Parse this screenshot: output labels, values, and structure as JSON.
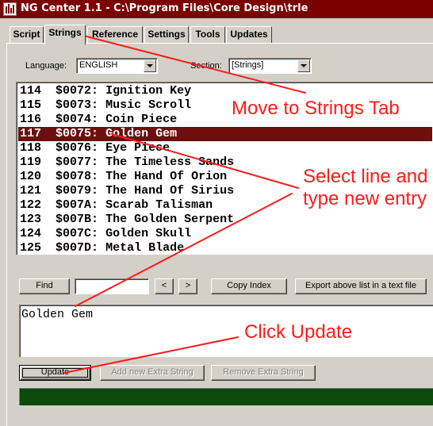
{
  "window": {
    "title": "NG Center 1.1 - C:\\Program Files\\Core Design\\trle"
  },
  "tabs": [
    {
      "label": "Script",
      "active": false
    },
    {
      "label": "Strings",
      "active": true
    },
    {
      "label": "Reference",
      "active": false
    },
    {
      "label": "Settings",
      "active": false
    },
    {
      "label": "Tools",
      "active": false
    },
    {
      "label": "Updates",
      "active": false
    }
  ],
  "filters": {
    "language_label": "Language:",
    "language_value": "ENGLISH",
    "section_label": "Section:",
    "section_value": "[Strings]"
  },
  "strings_list": {
    "rows": [
      {
        "index": "114",
        "code": "$0072:",
        "text": "Ignition Key"
      },
      {
        "index": "115",
        "code": "$0073:",
        "text": "Music Scroll"
      },
      {
        "index": "116",
        "code": "$0074:",
        "text": "Coin Piece"
      },
      {
        "index": "117",
        "code": "$0075:",
        "text": "Golden Gem"
      },
      {
        "index": "118",
        "code": "$0076:",
        "text": "Eye Piece"
      },
      {
        "index": "119",
        "code": "$0077:",
        "text": "The Timeless Sands"
      },
      {
        "index": "120",
        "code": "$0078:",
        "text": "The Hand Of Orion"
      },
      {
        "index": "121",
        "code": "$0079:",
        "text": "The Hand Of Sirius"
      },
      {
        "index": "122",
        "code": "$007A:",
        "text": "Scarab Talisman"
      },
      {
        "index": "123",
        "code": "$007B:",
        "text": "The Golden Serpent"
      },
      {
        "index": "124",
        "code": "$007C:",
        "text": "Golden Skull"
      },
      {
        "index": "125",
        "code": "$007D:",
        "text": "Metal Blade"
      }
    ],
    "selected_index": "117"
  },
  "toolbar": {
    "find_label": "Find",
    "find_value": "",
    "prev_label": "<",
    "next_label": ">",
    "copy_index_label": "Copy Index",
    "export_label": "Export above list in a text  file"
  },
  "editor": {
    "value": "Golden Gem"
  },
  "actions": {
    "update_label": "Update",
    "add_label": "Add new Extra String",
    "remove_label": "Remove Extra String"
  },
  "annotations": {
    "color": "#ff1a1a",
    "move_tab": "Move to Strings Tab",
    "select_line_1": "Select line and",
    "select_line_2": "type new entry",
    "click_update": "Click Update"
  }
}
